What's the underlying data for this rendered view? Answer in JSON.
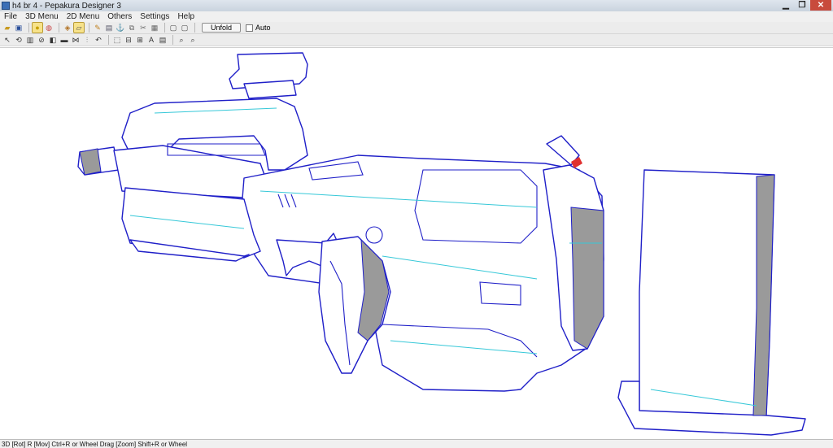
{
  "window": {
    "title": "h4 br 4 - Pepakura Designer 3"
  },
  "menubar": {
    "items": [
      "File",
      "3D Menu",
      "2D Menu",
      "Others",
      "Settings",
      "Help"
    ]
  },
  "toolbar": {
    "unfold_label": "Unfold",
    "auto_label": "Auto",
    "auto_checked": false
  },
  "statusbar": {
    "text": "3D [Rot] R [Mov] Ctrl+R or Wheel Drag [Zoom] Shift+R or Wheel"
  },
  "colors": {
    "edge": "#1f1fc8",
    "fold_line": "#36c8d8",
    "surface": "#ffffff",
    "shade": "#9a9a9a",
    "accent": "#e03030"
  },
  "icons": {
    "toolbar1": [
      "open-folder-icon",
      "save-icon",
      "bulb-icon",
      "texture-icon",
      "cube-icon",
      "select-icon",
      "pencil-icon",
      "box-icon",
      "anchor-icon",
      "copy-icon",
      "scissors-icon",
      "grid-icon",
      "window-icon",
      "window-icon"
    ],
    "toolbar2": [
      "move-icon",
      "rotate-icon",
      "image-icon",
      "edge-icon",
      "flap-icon",
      "rect-icon",
      "join-icon",
      "split-icon",
      "undo-icon",
      "group-icon",
      "align-icon",
      "ruler-icon",
      "text-icon",
      "layout-icon",
      "zoom-icon",
      "zoom-out-icon"
    ]
  }
}
